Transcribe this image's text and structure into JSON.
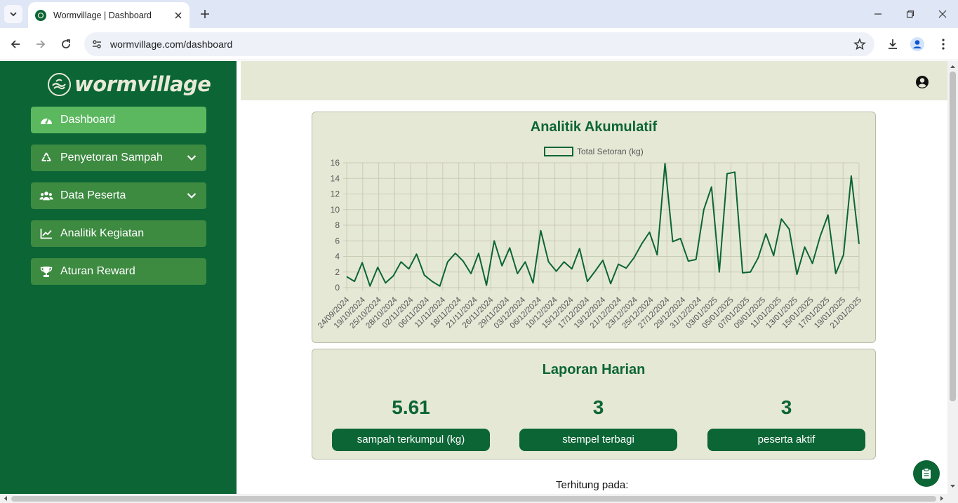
{
  "browser": {
    "tab_title": "Wormvillage | Dashboard",
    "url": "wormvillage.com/dashboard"
  },
  "sidebar": {
    "logo_text": "wormvillage",
    "items": [
      {
        "label": "Dashboard",
        "icon": "gauge-icon",
        "active": true
      },
      {
        "label": "Penyetoran Sampah",
        "icon": "recycle-icon",
        "has_submenu": true
      },
      {
        "label": "Data Peserta",
        "icon": "users-icon",
        "has_submenu": true
      },
      {
        "label": "Analitik Kegiatan",
        "icon": "line-chart-icon"
      },
      {
        "label": "Aturan Reward",
        "icon": "trophy-icon"
      }
    ]
  },
  "analytics": {
    "title": "Analitik Akumulatif"
  },
  "daily_report": {
    "title": "Laporan Harian",
    "stats": [
      {
        "value": "5.61",
        "label": "sampah terkumpul (kg)"
      },
      {
        "value": "3",
        "label": "stempel terbagi"
      },
      {
        "value": "3",
        "label": "peserta aktif"
      }
    ]
  },
  "computed_at_label": "Terhitung pada:",
  "colors": {
    "brand_green": "#0b6535",
    "menu_green": "#3d8a41",
    "menu_active": "#5cb85f",
    "card_bg": "#e6e8d6"
  },
  "chart_data": {
    "type": "line",
    "title": "",
    "legend": "top",
    "series": [
      {
        "name": "Total Setoran (kg)",
        "values": [
          1.4,
          0.8,
          3.2,
          0.2,
          2.6,
          0.6,
          1.5,
          3.3,
          2.4,
          4.3,
          1.6,
          0.8,
          0.2,
          3.3,
          4.4,
          3.4,
          1.8,
          4.4,
          0.3,
          6.0,
          2.8,
          5.1,
          1.8,
          3.3,
          0.6,
          7.3,
          3.3,
          2.1,
          3.3,
          2.4,
          5.0,
          0.8,
          2.1,
          3.5,
          0.5,
          3.0,
          2.5,
          3.8,
          5.6,
          7.1,
          4.2,
          15.9,
          5.9,
          6.3,
          3.4,
          3.6,
          10.0,
          12.9,
          2.0,
          14.6,
          14.8,
          1.9,
          2.0,
          3.8,
          6.9,
          4.1,
          8.8,
          7.5,
          1.7,
          5.2,
          3.1,
          6.6,
          9.3,
          1.8,
          4.2,
          14.3,
          5.6
        ]
      }
    ],
    "x_tick_labels": [
      "24/09/2024",
      "19/10/2024",
      "25/10/2024",
      "28/10/2024",
      "02/11/2024",
      "06/11/2024",
      "11/11/2024",
      "18/11/2024",
      "21/11/2024",
      "26/11/2024",
      "29/11/2024",
      "03/12/2024",
      "06/12/2024",
      "10/12/2024",
      "15/12/2024",
      "17/12/2024",
      "19/12/2024",
      "21/12/2024",
      "23/12/2024",
      "25/12/2024",
      "27/12/2024",
      "29/12/2024",
      "31/12/2024",
      "03/01/2025",
      "05/01/2025",
      "07/01/2025",
      "09/01/2025",
      "11/01/2025",
      "13/01/2025",
      "15/01/2025",
      "17/01/2025",
      "19/01/2025",
      "21/01/2025"
    ],
    "y_ticks": [
      0,
      2,
      4,
      6,
      8,
      10,
      12,
      14,
      16
    ],
    "ylim": [
      0,
      16
    ],
    "grid": true,
    "line_color": "#0b6535"
  }
}
